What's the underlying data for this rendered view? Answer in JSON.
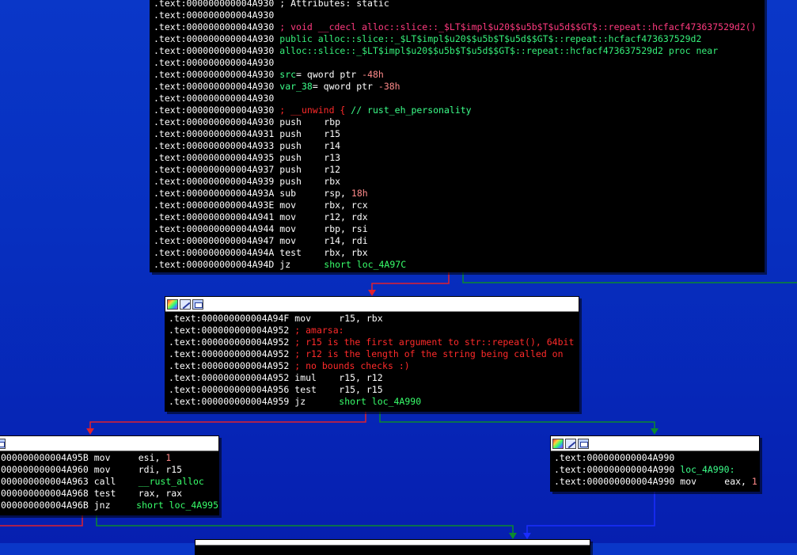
{
  "colors": {
    "background": "#0730c0",
    "edge_false": "#e0202e",
    "edge_true": "#0b8a2e",
    "edge_uncond": "#1a2dff",
    "comment": "#ff2a2a",
    "name": "#38ff6b"
  },
  "block_main": {
    "lines": [
      {
        "addr": ".text:000000000004A930",
        "text": "; Attributes: static",
        "style": "cmt-white"
      },
      {
        "addr": ".text:000000000004A930",
        "text": "",
        "style": "plain"
      },
      {
        "addr": ".text:000000000004A930",
        "text": "; void __cdecl alloc::slice::_$LT$impl$u20$$u5b$T$u5d$$GT$::repeat::hcfacf473637529d2()",
        "style": "cmt-pink"
      },
      {
        "addr": ".text:000000000004A930",
        "text": "public alloc::slice::_$LT$impl$u20$$u5b$T$u5d$$GT$::repeat::hcfacf473637529d2",
        "style": "green"
      },
      {
        "addr": ".text:000000000004A930",
        "text": "alloc::slice::_$LT$impl$u20$$u5b$T$u5d$$GT$::repeat::hcfacf473637529d2 proc near",
        "style": "green"
      },
      {
        "addr": ".text:000000000004A930",
        "text": "",
        "style": "plain"
      },
      {
        "addr": ".text:000000000004A930",
        "text": "src= qword ptr -48h",
        "style": "var"
      },
      {
        "addr": ".text:000000000004A930",
        "text": "var_38= qword ptr -38h",
        "style": "var"
      },
      {
        "addr": ".text:000000000004A930",
        "text": "",
        "style": "plain"
      },
      {
        "addr": ".text:000000000004A930",
        "text": "; __unwind { // rust_eh_personality",
        "style": "unwind"
      },
      {
        "addr": ".text:000000000004A930",
        "mn": "push",
        "op": "rbp"
      },
      {
        "addr": ".text:000000000004A931",
        "mn": "push",
        "op": "r15"
      },
      {
        "addr": ".text:000000000004A933",
        "mn": "push",
        "op": "r14"
      },
      {
        "addr": ".text:000000000004A935",
        "mn": "push",
        "op": "r13"
      },
      {
        "addr": ".text:000000000004A937",
        "mn": "push",
        "op": "r12"
      },
      {
        "addr": ".text:000000000004A939",
        "mn": "push",
        "op": "rbx"
      },
      {
        "addr": ".text:000000000004A93A",
        "mn": "sub",
        "op": "rsp, 18h"
      },
      {
        "addr": ".text:000000000004A93E",
        "mn": "mov",
        "op": "rbx, rcx"
      },
      {
        "addr": ".text:000000000004A941",
        "mn": "mov",
        "op": "r12, rdx"
      },
      {
        "addr": ".text:000000000004A944",
        "mn": "mov",
        "op": "rbp, rsi"
      },
      {
        "addr": ".text:000000000004A947",
        "mn": "mov",
        "op": "r14, rdi"
      },
      {
        "addr": ".text:000000000004A94A",
        "mn": "test",
        "op": "rbx, rbx"
      },
      {
        "addr": ".text:000000000004A94D",
        "mn": "jz",
        "op": "short loc_4A97C"
      }
    ]
  },
  "block_4a94f": {
    "lines": [
      {
        "addr": ".text:000000000004A94F",
        "mn": "mov",
        "op": "r15, rbx"
      },
      {
        "addr": ".text:000000000004A952",
        "text": "; amarsa:",
        "style": "cmt-red"
      },
      {
        "addr": ".text:000000000004A952",
        "text": "; r15 is the first argument to str::repeat(), 64bit",
        "style": "cmt-red"
      },
      {
        "addr": ".text:000000000004A952",
        "text": "; r12 is the length of the string being called on",
        "style": "cmt-red"
      },
      {
        "addr": ".text:000000000004A952",
        "text": "; no bounds checks :)",
        "style": "cmt-red"
      },
      {
        "addr": ".text:000000000004A952",
        "mn": "imul",
        "op": "r15, r12"
      },
      {
        "addr": ".text:000000000004A956",
        "mn": "test",
        "op": "r15, r15"
      },
      {
        "addr": ".text:000000000004A959",
        "mn": "jz",
        "op": "short loc_4A990"
      }
    ]
  },
  "block_4a95b": {
    "lines": [
      {
        "addr": "000000000004A95B",
        "mn": "mov",
        "op": "esi, 1"
      },
      {
        "addr": "000000000004A960",
        "mn": "mov",
        "op": "rdi, r15"
      },
      {
        "addr": "000000000004A963",
        "mn": "call",
        "op": "__rust_alloc"
      },
      {
        "addr": "000000000004A968",
        "mn": "test",
        "op": "rax, rax"
      },
      {
        "addr": "000000000004A96B",
        "mn": "jnz",
        "op": "short loc_4A995"
      }
    ]
  },
  "block_4a990": {
    "lines": [
      {
        "addr": ".text:000000000004A990",
        "text": "",
        "style": "plain"
      },
      {
        "addr": ".text:000000000004A990",
        "text": "loc_4A990:",
        "style": "label"
      },
      {
        "addr": ".text:000000000004A990",
        "mn": "mov",
        "op": "eax, 1"
      }
    ]
  }
}
